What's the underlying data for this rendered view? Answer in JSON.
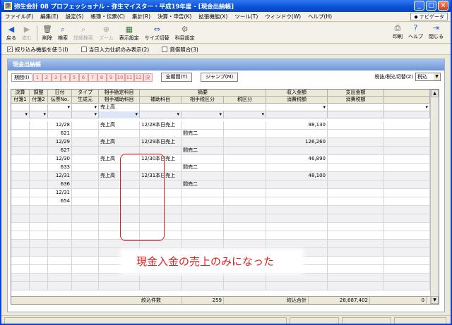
{
  "window": {
    "title": "弥生会計 08 プロフェッショナル - 弥生マイスター・平成19年度 - [現金出納帳]",
    "app_icon": "弥"
  },
  "menu": [
    "ファイル(F)",
    "編集(E)",
    "設定(S)",
    "帳簿・伝票(C)",
    "集計(R)",
    "決算・申告(K)",
    "拡張機能(X)",
    "ツール(T)",
    "ウィンドウ(W)",
    "ヘルプ(H)"
  ],
  "navi_label": "ナビゲータ",
  "toolbar": {
    "back": "戻る",
    "forward": "進む",
    "delete": "削除",
    "search": "検索",
    "search_detail": "詳細検索",
    "zoom": "ズーム",
    "display_settings": "表示設定",
    "size_switch": "サイズ切替",
    "account_settings": "科目設定",
    "print": "印刷",
    "help": "ヘルプ",
    "close": "閉じる"
  },
  "checks": [
    {
      "label": "絞り込み機能を使う(I)",
      "checked": "✓"
    },
    {
      "label": "当日入力仕訳のみ表示(2)",
      "checked": ""
    },
    {
      "label": "貸借照合(3)",
      "checked": ""
    }
  ],
  "panel_title": "現金出納帳",
  "period": {
    "label": "期間(I)",
    "months": [
      "1",
      "2",
      "3",
      "4",
      "5",
      "6",
      "7",
      "8",
      "9",
      "10",
      "11",
      "12",
      "決"
    ],
    "all": "全期間(Y)",
    "jump": "ジャンプ(M)",
    "tax_label": "税抜/税込切替(Z)",
    "tax_value": "税込"
  },
  "headers": {
    "top": [
      "決算",
      "調整",
      "日付",
      "タイプ",
      "相手勘定科目",
      "摘要",
      "収入金額",
      "支出金額"
    ],
    "bottom": [
      "付箋1",
      "付箋2",
      "伝票No.",
      "生成元",
      "相手補助科目",
      "補助科目",
      "相手税区分",
      "税区分",
      "消費税額",
      "消費税額"
    ]
  },
  "filter_value": "売上高",
  "rows": [
    {
      "date": "12/28",
      "account": "売上高",
      "summary": "12/28本日売上",
      "partner_tax": "",
      "income": "98,130"
    },
    {
      "date": "621",
      "account": "",
      "summary": "",
      "partner_tax": "間売二",
      "income": ""
    },
    {
      "date": "12/29",
      "account": "売上高",
      "summary": "12/29本日売上",
      "partner_tax": "",
      "income": "126,260"
    },
    {
      "date": "627",
      "account": "",
      "summary": "",
      "partner_tax": "間売二",
      "income": ""
    },
    {
      "date": "12/30",
      "account": "売上高",
      "summary": "12/30本日売上",
      "partner_tax": "",
      "income": "46,890"
    },
    {
      "date": "633",
      "account": "",
      "summary": "",
      "partner_tax": "間売二",
      "income": ""
    },
    {
      "date": "12/31",
      "account": "売上高",
      "summary": "12/31本日売上",
      "partner_tax": "",
      "income": "48,100"
    },
    {
      "date": "636",
      "account": "",
      "summary": "",
      "partner_tax": "間売二",
      "income": ""
    },
    {
      "date": "12/31",
      "account": "",
      "summary": "",
      "partner_tax": "",
      "income": ""
    },
    {
      "date": "654",
      "account": "",
      "summary": "",
      "partner_tax": "",
      "income": ""
    }
  ],
  "totals": {
    "count_label": "絞込件数",
    "count": "259",
    "sum_label": "絞込合計",
    "income_sum": "28,687,402",
    "expense_sum": "0"
  },
  "annotation": "現金入金の売上のみになった",
  "colors": {
    "title_blue": "#0a4fd4",
    "annotation_red": "#e0201e"
  }
}
